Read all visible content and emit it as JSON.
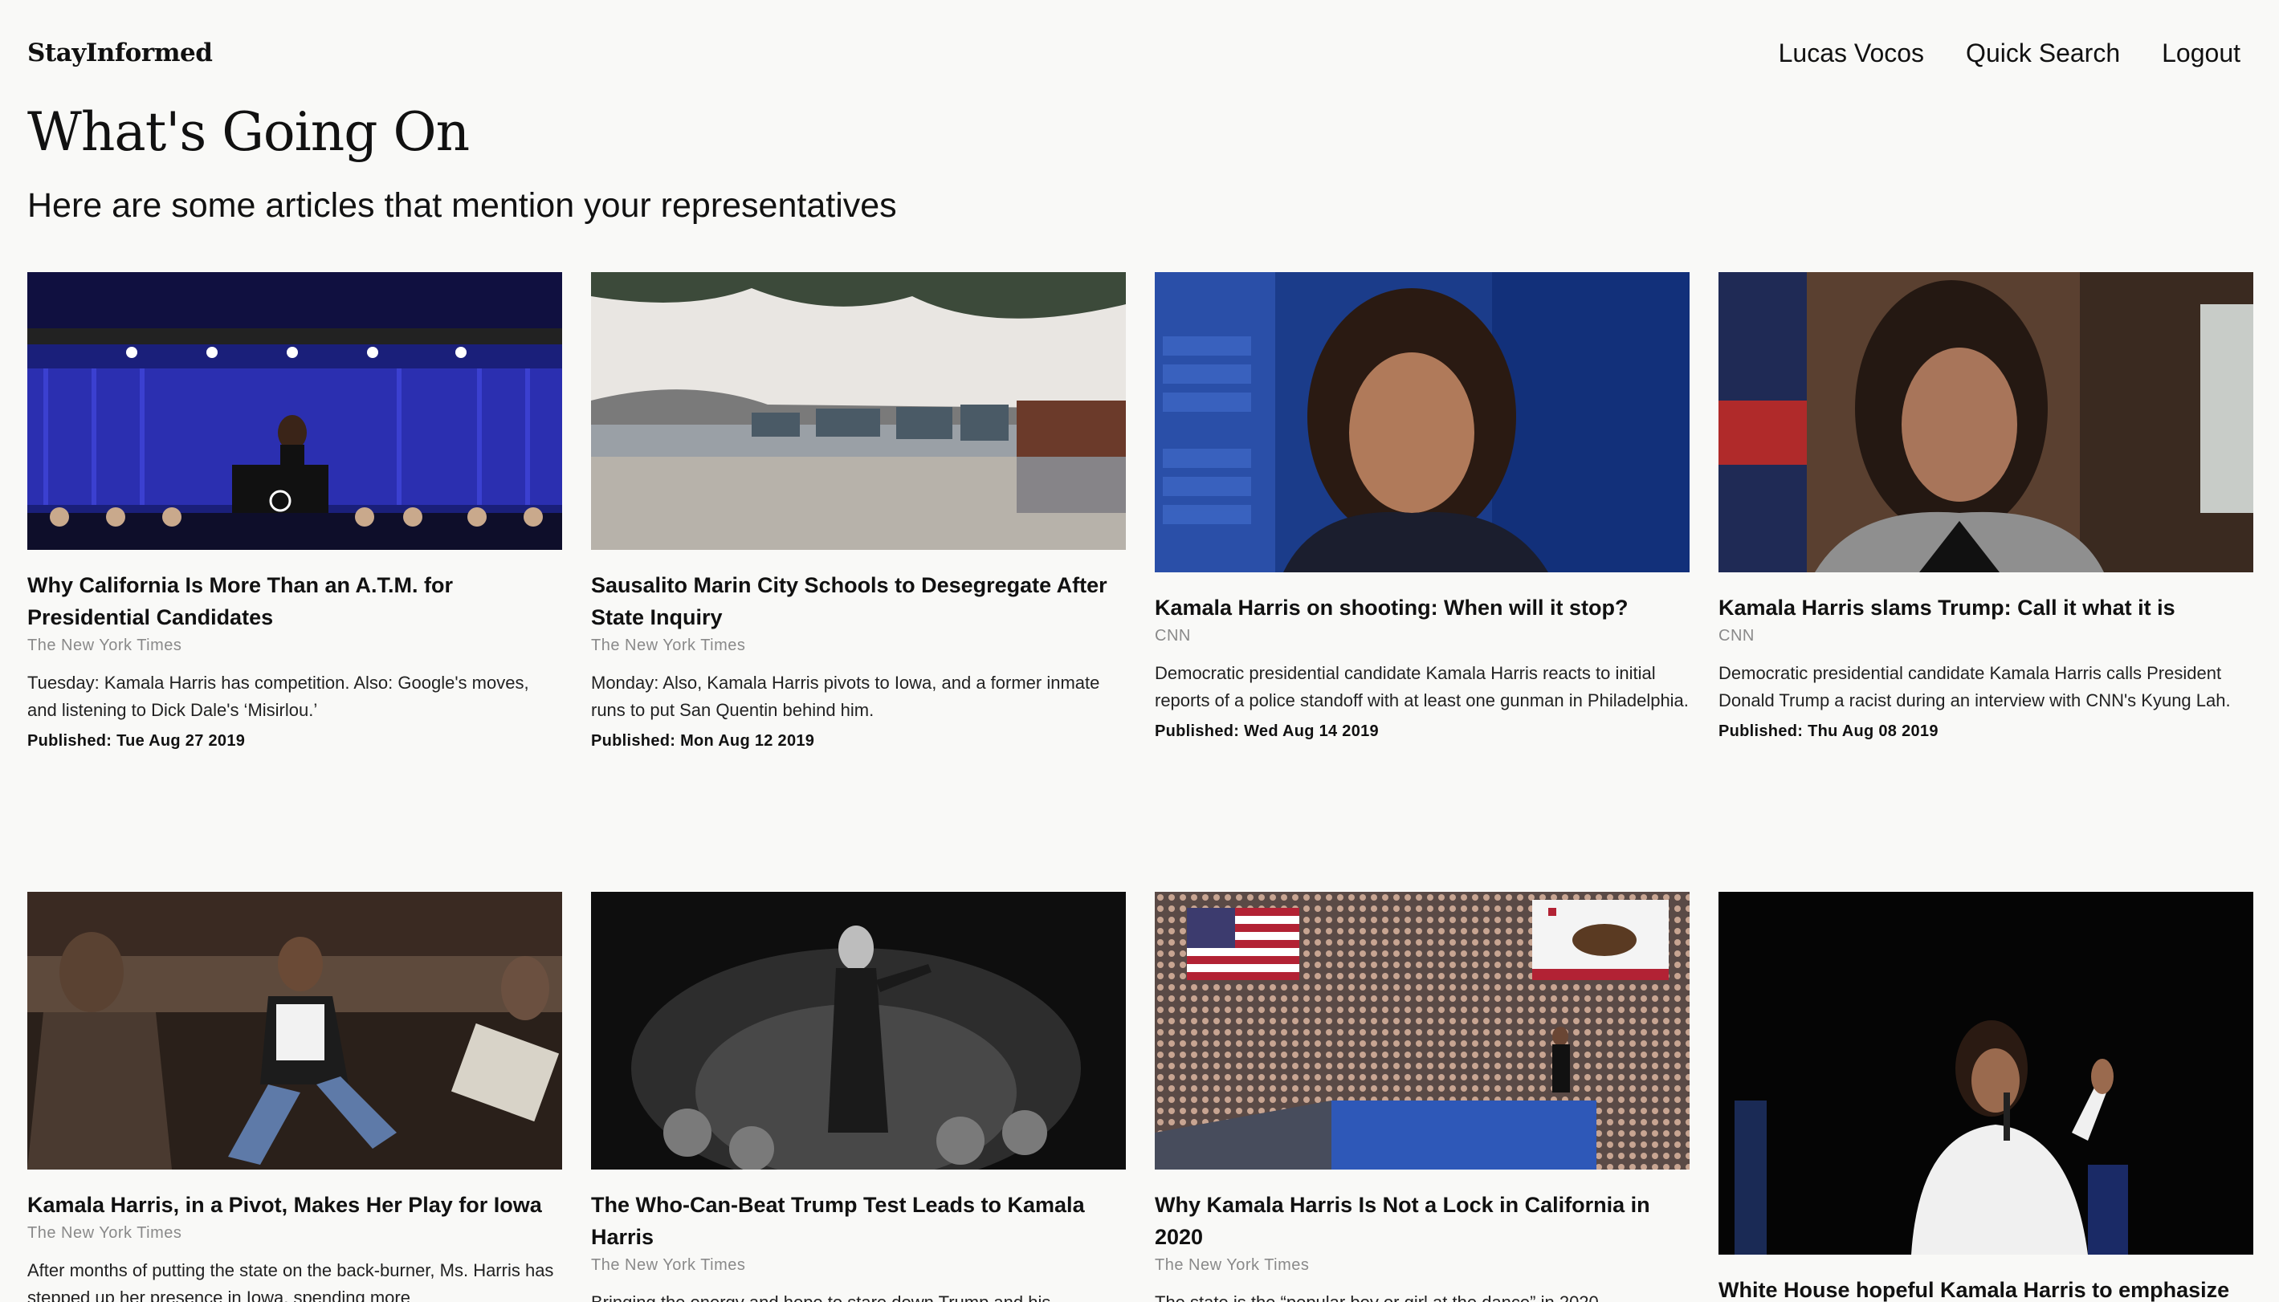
{
  "header": {
    "brand": "StayInformed",
    "nav": [
      "Lucas Vocos",
      "Quick Search",
      "Logout"
    ]
  },
  "page": {
    "title": "What's Going On",
    "subtitle": "Here are some articles that mention your representatives"
  },
  "articles": [
    {
      "title": "Why California Is More Than an A.T.M. for Presidential Candidates",
      "source": "The New York Times",
      "description": "Tuesday: Kamala Harris has competition. Also: Google's moves, and listening to Dick Dale's ‘Misirlou.’",
      "published": "Published: Tue Aug 27 2019",
      "image": "stage-rally-blue"
    },
    {
      "title": "Sausalito Marin City Schools to Desegregate After State Inquiry",
      "source": "The New York Times",
      "description": "Monday: Also, Kamala Harris pivots to Iowa, and a former inmate runs to put San Quentin behind him.",
      "published": "Published: Mon Aug 12 2019",
      "image": "houseboats-bay"
    },
    {
      "title": "Kamala Harris on shooting: When will it stop?",
      "source": "CNN",
      "description": "Democratic presidential candidate Kamala Harris reacts to initial reports of a police standoff with at least one gunman in Philadelphia.",
      "published": "Published: Wed Aug 14 2019",
      "image": "interview-blue-studio"
    },
    {
      "title": "Kamala Harris slams Trump: Call it what it is",
      "source": "CNN",
      "description": "Democratic presidential candidate Kamala Harris calls President Donald Trump a racist during an interview with CNN's Kyung Lah.",
      "published": "Published: Thu Aug 08 2019",
      "image": "interview-bus"
    },
    {
      "title": "Kamala Harris, in a Pivot, Makes Her Play for Iowa",
      "source": "The New York Times",
      "description": "After months of putting the state on the back-burner, Ms. Harris has stepped up her presence in Iowa, spending more",
      "image": "bus-interior"
    },
    {
      "title": "The Who-Can-Beat Trump Test Leads to Kamala Harris",
      "source": "The New York Times",
      "description": "Bringing the energy and hope to stare down Trump and his movement.",
      "image": "bw-speech"
    },
    {
      "title": "Why Kamala Harris Is Not a Lock in California in 2020",
      "source": "The New York Times",
      "description": "The state is the “popular boy or girl at the dance” in 2020",
      "image": "crowd-rally-california"
    },
    {
      "title": "White House hopeful Kamala Harris to emphasize",
      "image": "speaker-dark-stage"
    }
  ],
  "colors": {
    "background": "#f9f9f7",
    "text": "#111111",
    "source": "#8a8a8a"
  }
}
